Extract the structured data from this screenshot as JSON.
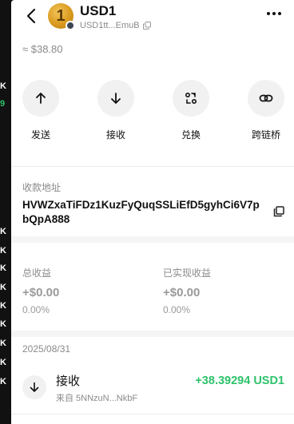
{
  "background_fragments": [
    {
      "text": "K",
      "color": "white"
    },
    {
      "text": "9",
      "color": "green"
    },
    {
      "text": "K",
      "color": "white"
    },
    {
      "text": "K",
      "color": "white"
    },
    {
      "text": "K",
      "color": "white"
    },
    {
      "text": "K",
      "color": "white"
    },
    {
      "text": "K",
      "color": "white"
    },
    {
      "text": "K",
      "color": "white"
    },
    {
      "text": "K",
      "color": "white"
    },
    {
      "text": "K",
      "color": "white"
    },
    {
      "text": "K",
      "color": "white"
    }
  ],
  "header": {
    "token_symbol": "USD1",
    "token_logo_char": "1",
    "token_address_short": "USD1tt...EmuB"
  },
  "fiat_value": "≈ $38.80",
  "actions": [
    {
      "label": "发送",
      "icon": "arrow-up-icon"
    },
    {
      "label": "接收",
      "icon": "arrow-down-icon"
    },
    {
      "label": "兑换",
      "icon": "swap-icon"
    },
    {
      "label": "跨链桥",
      "icon": "link-icon"
    }
  ],
  "deposit": {
    "label": "收款地址",
    "address": "HVWZxaTiFDz1KuzFyQuqSSLiEfD5gyhCi6V7pbQpA888"
  },
  "earnings": {
    "total_label": "总收益",
    "total_value": "+$0.00",
    "total_pct": "0.00%",
    "realized_label": "已实现收益",
    "realized_value": "+$0.00",
    "realized_pct": "0.00%"
  },
  "history": {
    "date": "2025/08/31",
    "transactions": [
      {
        "type": "接收",
        "from": "来自 5NNzuN...NkbF",
        "amount": "+38.39294 USD1"
      }
    ]
  },
  "colors": {
    "positive": "#2ec26b",
    "muted": "#8a8a8a",
    "button_bg": "#f1f1f1"
  }
}
